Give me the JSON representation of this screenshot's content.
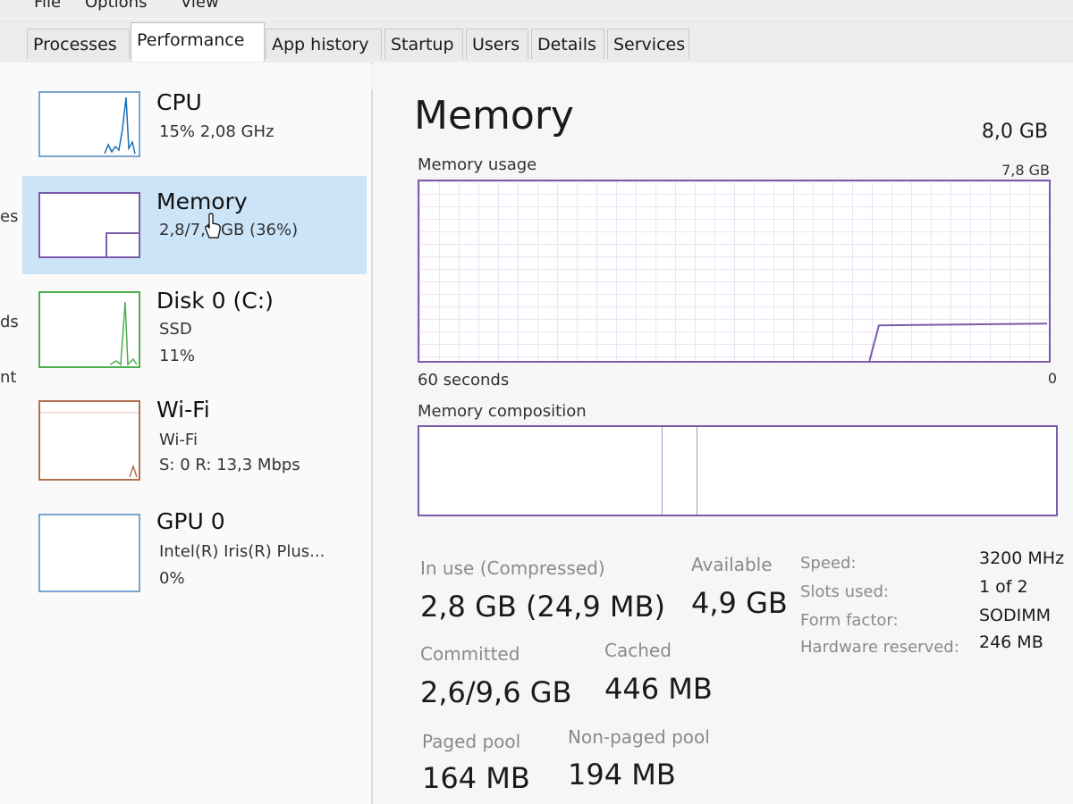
{
  "menu": [
    "File",
    "Options",
    "View"
  ],
  "tabs": [
    "Processes",
    "Performance",
    "App history",
    "Startup",
    "Users",
    "Details",
    "Services"
  ],
  "active_tab": "Performance",
  "edge_fragments": [
    "es",
    "ds",
    "nt"
  ],
  "resources": [
    {
      "title": "CPU",
      "line1": "15% 2,08 GHz",
      "line2": ""
    },
    {
      "title": "Memory",
      "line1": "2,8/7,8 GB (36%)",
      "line2": ""
    },
    {
      "title": "Disk 0 (C:)",
      "line1": "SSD",
      "line2": "11%"
    },
    {
      "title": "Wi-Fi",
      "line1": "Wi-Fi",
      "line2": "S: 0 R: 13,3 Mbps"
    },
    {
      "title": "GPU 0",
      "line1": "Intel(R) Iris(R) Plus...",
      "line2": "0%"
    }
  ],
  "memory": {
    "title": "Memory",
    "total": "8,0 GB",
    "usage_label": "Memory usage",
    "usage_max": "7,8 GB",
    "time_label": "60 seconds",
    "zero_label": "0",
    "composition_label": "Memory composition",
    "usage_level_fraction": 0.36,
    "composition_fractions": [
      0.38,
      0.055
    ]
  },
  "stats": {
    "in_use_label": "In use (Compressed)",
    "in_use_value": "2,8 GB (24,9 MB)",
    "available_label": "Available",
    "available_value": "4,9 GB",
    "committed_label": "Committed",
    "committed_value": "2,6/9,6 GB",
    "cached_label": "Cached",
    "cached_value": "446 MB",
    "paged_label": "Paged pool",
    "paged_value": "164 MB",
    "nonpaged_label": "Non-paged pool",
    "nonpaged_value": "194 MB"
  },
  "specs": [
    {
      "key": "Speed:",
      "value": "3200 MHz"
    },
    {
      "key": "Slots used:",
      "value": "1 of 2"
    },
    {
      "key": "Form factor:",
      "value": "SODIMM"
    },
    {
      "key": "Hardware reserved:",
      "value": "246 MB"
    }
  ],
  "colors": {
    "selection": "#cce4f7",
    "memory_accent": "#7a5ca9",
    "cpu_accent": "#1a6fb5",
    "disk_accent": "#4caf50"
  }
}
